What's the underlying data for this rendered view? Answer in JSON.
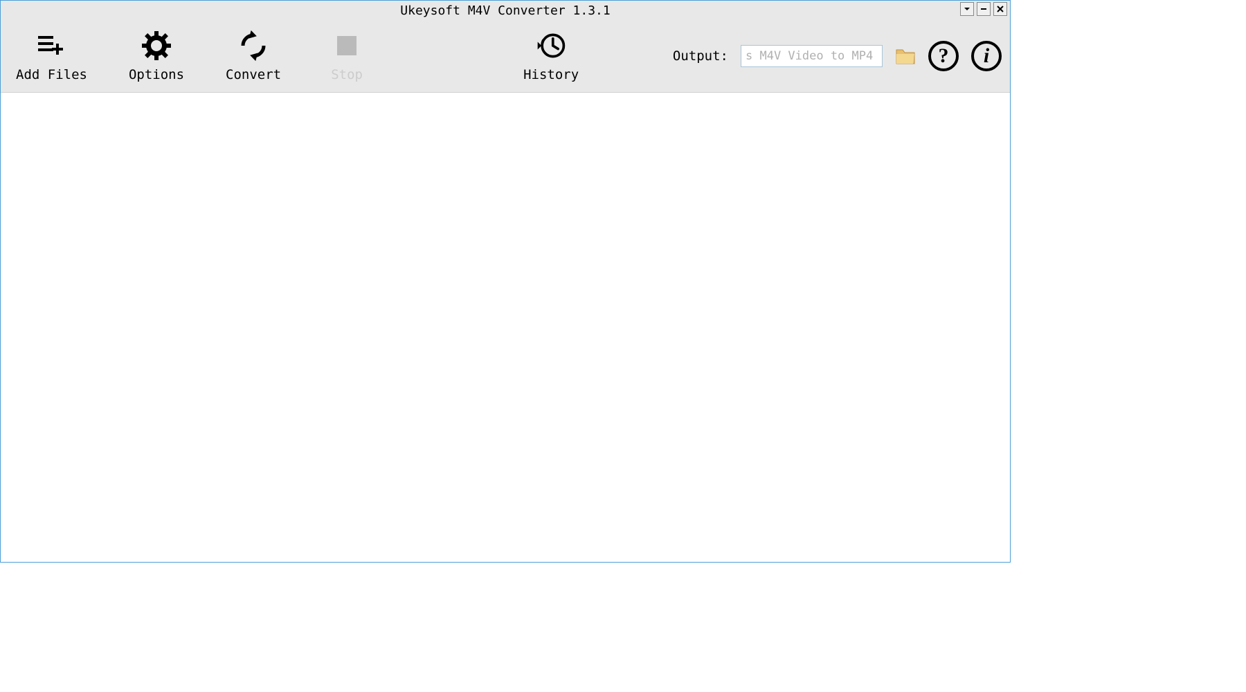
{
  "titlebar": {
    "title": "Ukeysoft M4V Converter 1.3.1"
  },
  "toolbar": {
    "add_files": "Add Files",
    "options": "Options",
    "convert": "Convert",
    "stop": "Stop",
    "history": "History",
    "output_label": "Output:",
    "output_value": "s M4V Video to MP4"
  }
}
